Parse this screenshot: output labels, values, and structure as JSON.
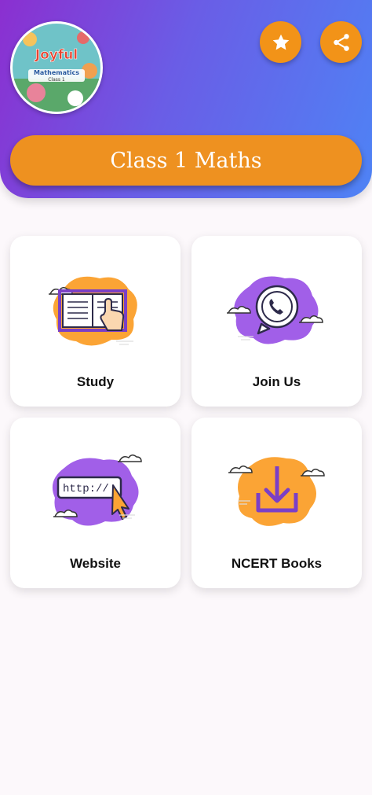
{
  "header": {
    "logo": {
      "icon": "book-cover-logo",
      "text_line1": "Joyful",
      "text_line2": "Mathematics",
      "text_line3": "Class 1"
    },
    "star_icon": "star-icon",
    "share_icon": "share-icon",
    "title": "Class 1 Maths"
  },
  "menu": [
    {
      "label": "Study",
      "icon": "open-book-icon"
    },
    {
      "label": "Join Us",
      "icon": "whatsapp-icon"
    },
    {
      "label": "Website",
      "icon": "browser-url-icon",
      "url_text": "http://"
    },
    {
      "label": "NCERT Books",
      "icon": "download-icon"
    }
  ],
  "colors": {
    "accent": "#EE9120",
    "purple": "#8B2FD0",
    "blue": "#4E83F5",
    "blob_orange": "#FBA435",
    "blob_purple": "#A15FE8"
  }
}
